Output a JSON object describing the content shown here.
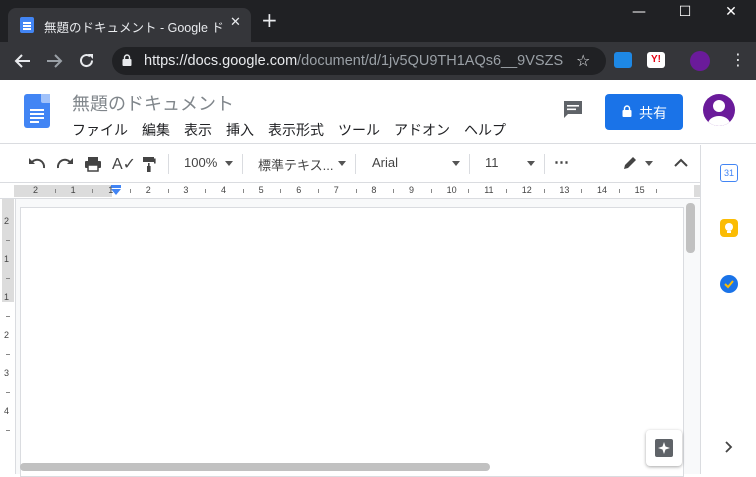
{
  "browser": {
    "tab_title": "無題のドキュメント - Google ドキュメント",
    "tab_close": "✕",
    "new_tab": "+",
    "window_controls": {
      "minimize": "—",
      "maximize": "☐",
      "close": "✕"
    },
    "url_host": "https://docs.google.com",
    "url_path": "/document/d/1jv5QU9TH1AQs6__9VSZS...",
    "ext_yahoo": "Y!"
  },
  "doc": {
    "title": "無題のドキュメント",
    "menu": [
      "ファイル",
      "編集",
      "表示",
      "挿入",
      "表示形式",
      "ツール",
      "アドオン",
      "ヘルプ"
    ],
    "share_label": "共有"
  },
  "format_toolbar": {
    "zoom": "100%",
    "style": "標準テキス...",
    "font": "Arial",
    "size": "11",
    "more": "⋯"
  },
  "ruler": {
    "h_numbers": [
      "2",
      "1",
      "1",
      "2",
      "3",
      "4",
      "5",
      "6",
      "7",
      "8",
      "9",
      "10",
      "11",
      "12",
      "13",
      "14",
      "15"
    ],
    "v_numbers": [
      "2",
      "1",
      "1",
      "2",
      "3",
      "4"
    ]
  },
  "colors": {
    "accent": "#1a73e8",
    "docs_blue": "#4285f4",
    "chrome_dark": "#202124",
    "chrome_toolbar": "#35363a"
  }
}
